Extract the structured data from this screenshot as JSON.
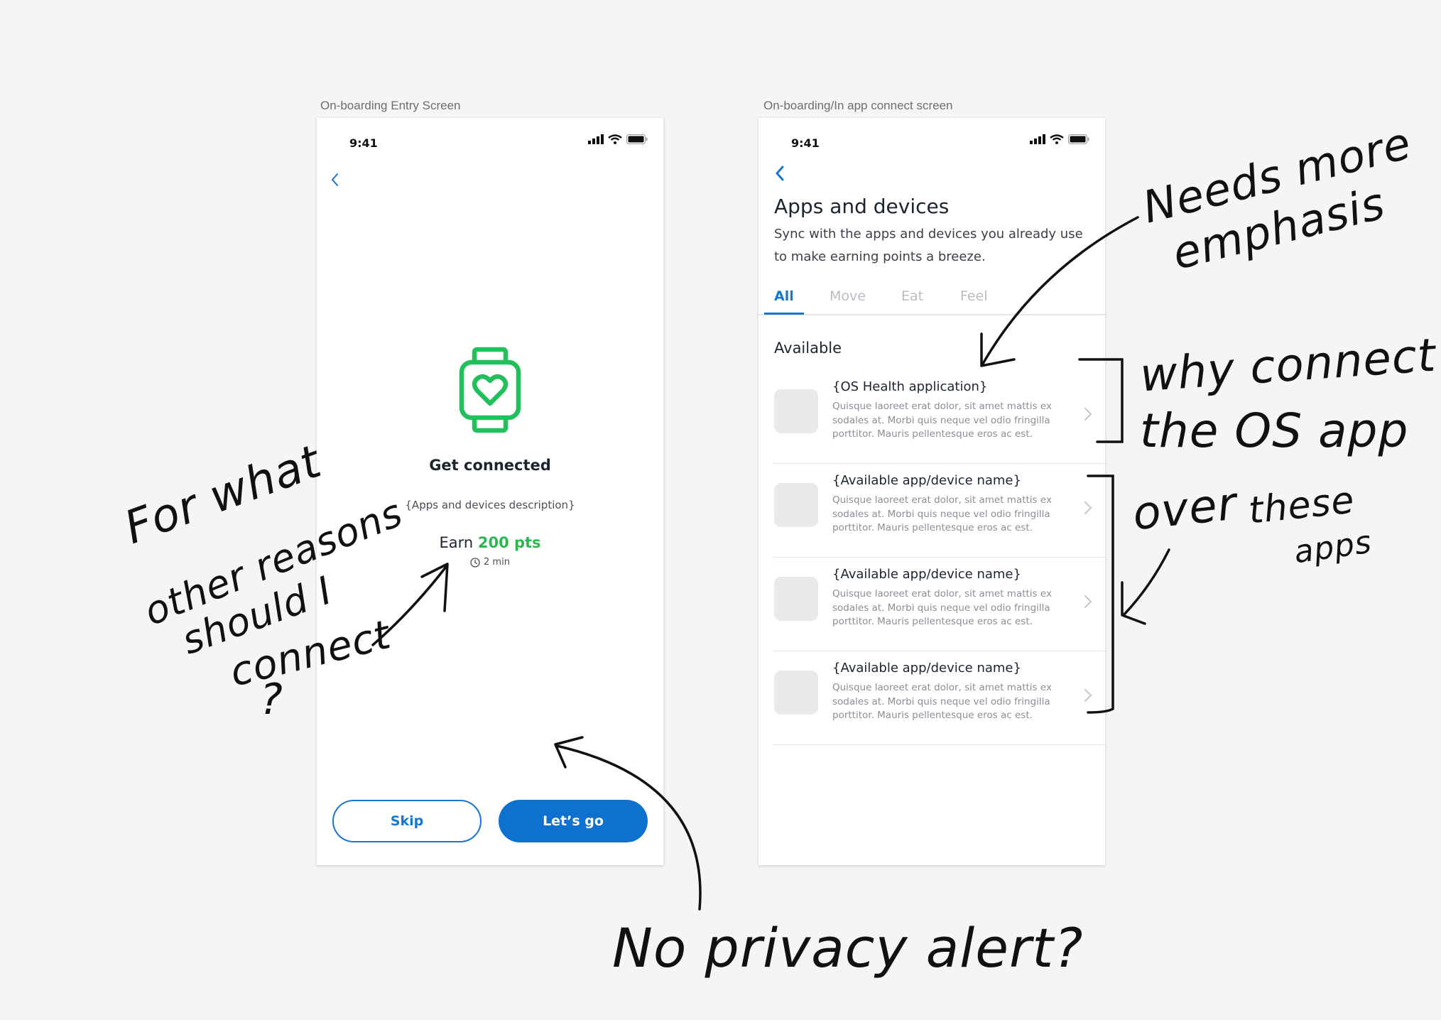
{
  "frames": {
    "entry_label": "On-boarding Entry Screen",
    "connect_label": "On-boarding/In app connect screen"
  },
  "status_bar": {
    "time": "9:41"
  },
  "entry_screen": {
    "icon": "smartwatch-heart-icon",
    "title": "Get connected",
    "description": "{Apps and devices description}",
    "earn_prefix": "Earn",
    "earn_points": "200 pts",
    "duration": "2 min",
    "skip_label": "Skip",
    "go_label": "Let’s go"
  },
  "connect_screen": {
    "title": "Apps and devices",
    "subtitle": "Sync with the apps and devices you already use to make earning points a breeze.",
    "tabs": [
      {
        "label": "All",
        "active": true
      },
      {
        "label": "Move",
        "active": false
      },
      {
        "label": "Eat",
        "active": false
      },
      {
        "label": "Feel",
        "active": false
      }
    ],
    "section_title": "Available",
    "items": [
      {
        "name": "{OS Health application}",
        "description": "Quisque laoreet erat dolor, sit amet mattis ex sodales at. Morbi quis neque vel odio fringilla porttitor. Mauris pellentesque eros ac est."
      },
      {
        "name": "{Available app/device name}",
        "description": "Quisque laoreet erat dolor, sit amet mattis ex sodales at. Morbi quis neque vel odio fringilla porttitor. Mauris pellentesque eros ac est."
      },
      {
        "name": "{Available app/device name}",
        "description": "Quisque laoreet erat dolor, sit amet mattis ex sodales at. Morbi quis neque vel odio fringilla porttitor. Mauris pellentesque eros ac est."
      },
      {
        "name": "{Available app/device name}",
        "description": "Quisque laoreet erat dolor, sit amet mattis ex sodales at. Morbi quis neque vel odio fringilla porttitor. Mauris pellentesque eros ac est."
      }
    ]
  },
  "annotations": {
    "reasons": [
      "For what",
      "other reasons",
      "should I",
      "connect",
      "?"
    ],
    "emphasis": [
      "Needs more",
      "emphasis"
    ],
    "why_os": [
      "why connect",
      "the  OS app",
      "over",
      "these",
      "apps"
    ],
    "privacy": "No privacy alert?"
  },
  "colors": {
    "primary_blue": "#0e71cf",
    "points_green": "#2fb74f",
    "watch_icon_green": "#22c05a"
  }
}
